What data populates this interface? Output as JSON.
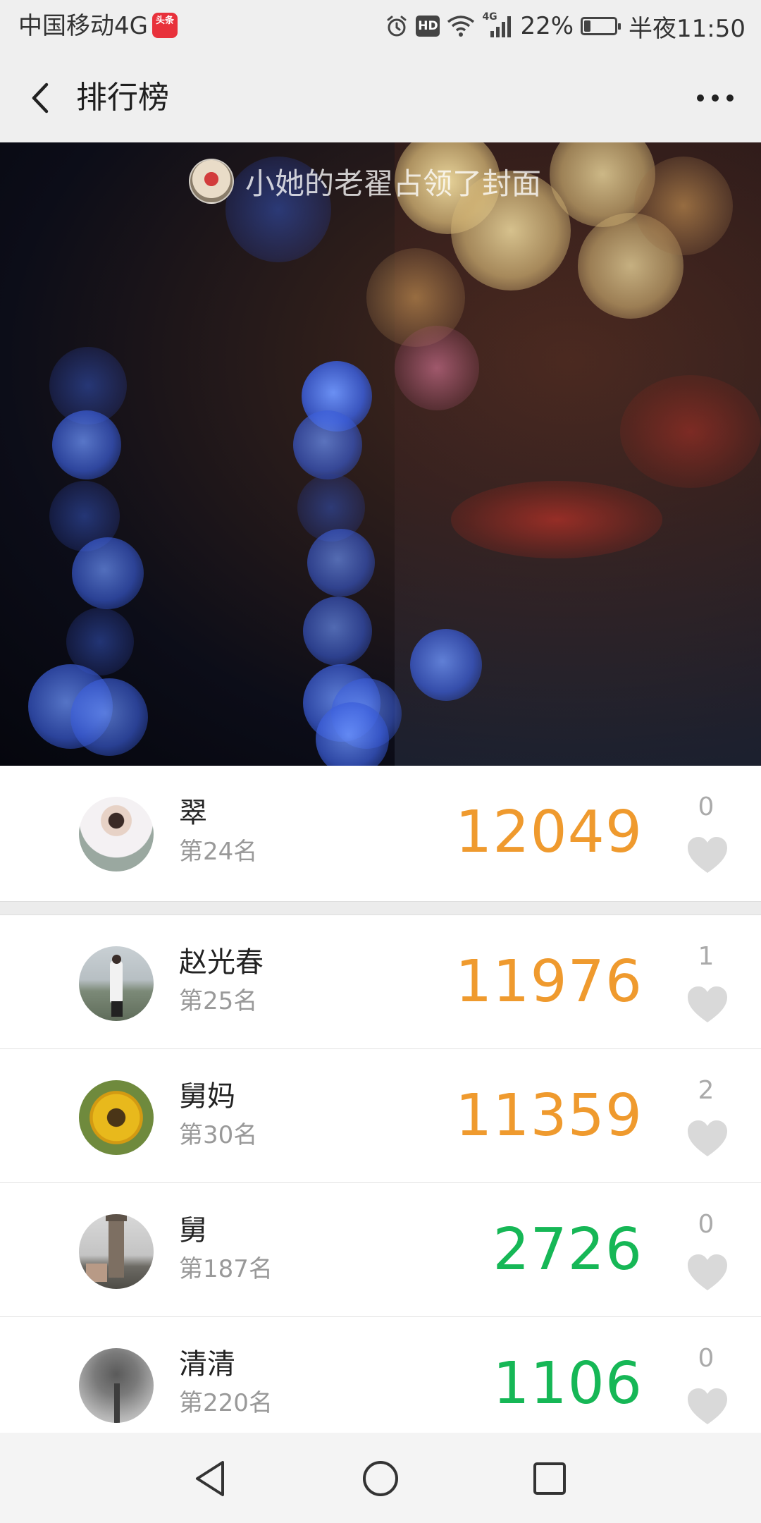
{
  "status_bar": {
    "carrier": "中国移动4G",
    "app_badge": "头条",
    "network": "4G",
    "battery": "22%",
    "battery_level": 0.22,
    "time": "半夜11:50",
    "icons": [
      "alarm-icon",
      "hd-icon",
      "wifi-icon",
      "signal-icon",
      "battery-icon"
    ]
  },
  "header": {
    "title": "排行榜",
    "back_icon": "chevron-left-icon",
    "more_icon": "more-dots-icon"
  },
  "cover": {
    "owner_text": "小她的老翟占领了封面"
  },
  "rankings": [
    {
      "name": "翠",
      "rank": "第24名",
      "steps": "12049",
      "likes": "0",
      "color": "#ef9a2e",
      "is_me": true
    },
    {
      "name": "赵光春",
      "rank": "第25名",
      "steps": "11976",
      "likes": "1",
      "color": "#ef9a2e",
      "is_me": false
    },
    {
      "name": "舅妈",
      "rank": "第30名",
      "steps": "11359",
      "likes": "2",
      "color": "#ef9a2e",
      "is_me": false
    },
    {
      "name": "舅",
      "rank": "第187名",
      "steps": "2726",
      "likes": "0",
      "color": "#16b756",
      "is_me": false
    },
    {
      "name": "清清",
      "rank": "第220名",
      "steps": "1106",
      "likes": "0",
      "color": "#16b756",
      "is_me": false
    }
  ],
  "navbar": {
    "icons": [
      "back-triangle-icon",
      "home-circle-icon",
      "recents-square-icon"
    ]
  }
}
